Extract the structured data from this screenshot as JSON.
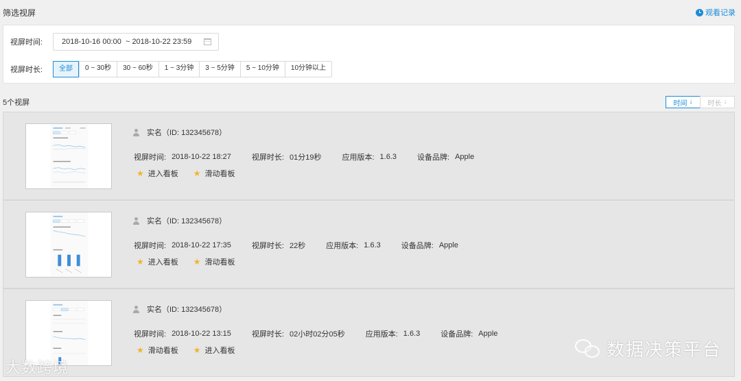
{
  "header": {
    "title": "筛选视屏",
    "history_label": "观看记录"
  },
  "filters": {
    "time_label": "视屏时间:",
    "date_range": "2018-10-16 00:00  ~ 2018-10-22 23:59",
    "duration_label": "视屏时长:",
    "duration_options": [
      "全部",
      "0 ~ 30秒",
      "30 ~ 60秒",
      "1 ~ 3分钟",
      "3 ~ 5分钟",
      "5 ~ 10分钟",
      "10分钟以上"
    ],
    "duration_selected": "全部"
  },
  "list_header": {
    "count_text": "5个视屏",
    "sort_time": "时间",
    "sort_duration": "时长",
    "sort_active": "时间"
  },
  "records": [
    {
      "user": "实名（ID: 132345678）",
      "time_label": "视屏时间:",
      "time_value": "2018-10-22 18:27",
      "duration_label": "视屏时长:",
      "duration_value": "01分19秒",
      "version_label": "应用版本:",
      "version_value": "1.6.3",
      "brand_label": "设备品牌:",
      "brand_value": "Apple",
      "tags": [
        "进入看板",
        "滑动看板"
      ]
    },
    {
      "user": "实名（ID: 132345678）",
      "time_label": "视屏时间:",
      "time_value": "2018-10-22 17:35",
      "duration_label": "视屏时长:",
      "duration_value": "22秒",
      "version_label": "应用版本:",
      "version_value": "1.6.3",
      "brand_label": "设备品牌:",
      "brand_value": "Apple",
      "tags": [
        "进入看板",
        "滑动看板"
      ]
    },
    {
      "user": "实名（ID: 132345678）",
      "time_label": "视屏时间:",
      "time_value": "2018-10-22 13:15",
      "duration_label": "视屏时长:",
      "duration_value": "02小时02分05秒",
      "version_label": "应用版本:",
      "version_value": "1.6.3",
      "brand_label": "设备品牌:",
      "brand_value": "Apple",
      "tags": [
        "滑动看板",
        "进入看板"
      ]
    }
  ],
  "watermarks": {
    "left": "大数跨境",
    "right": "数据决策平台"
  },
  "colors": {
    "accent": "#1a8cd8",
    "star": "#f0b429",
    "card_bg": "#e6e6e6"
  },
  "icons": [
    "clock-icon",
    "calendar-icon",
    "arrow-down-icon",
    "person-icon",
    "star-icon",
    "wechat-icon"
  ]
}
